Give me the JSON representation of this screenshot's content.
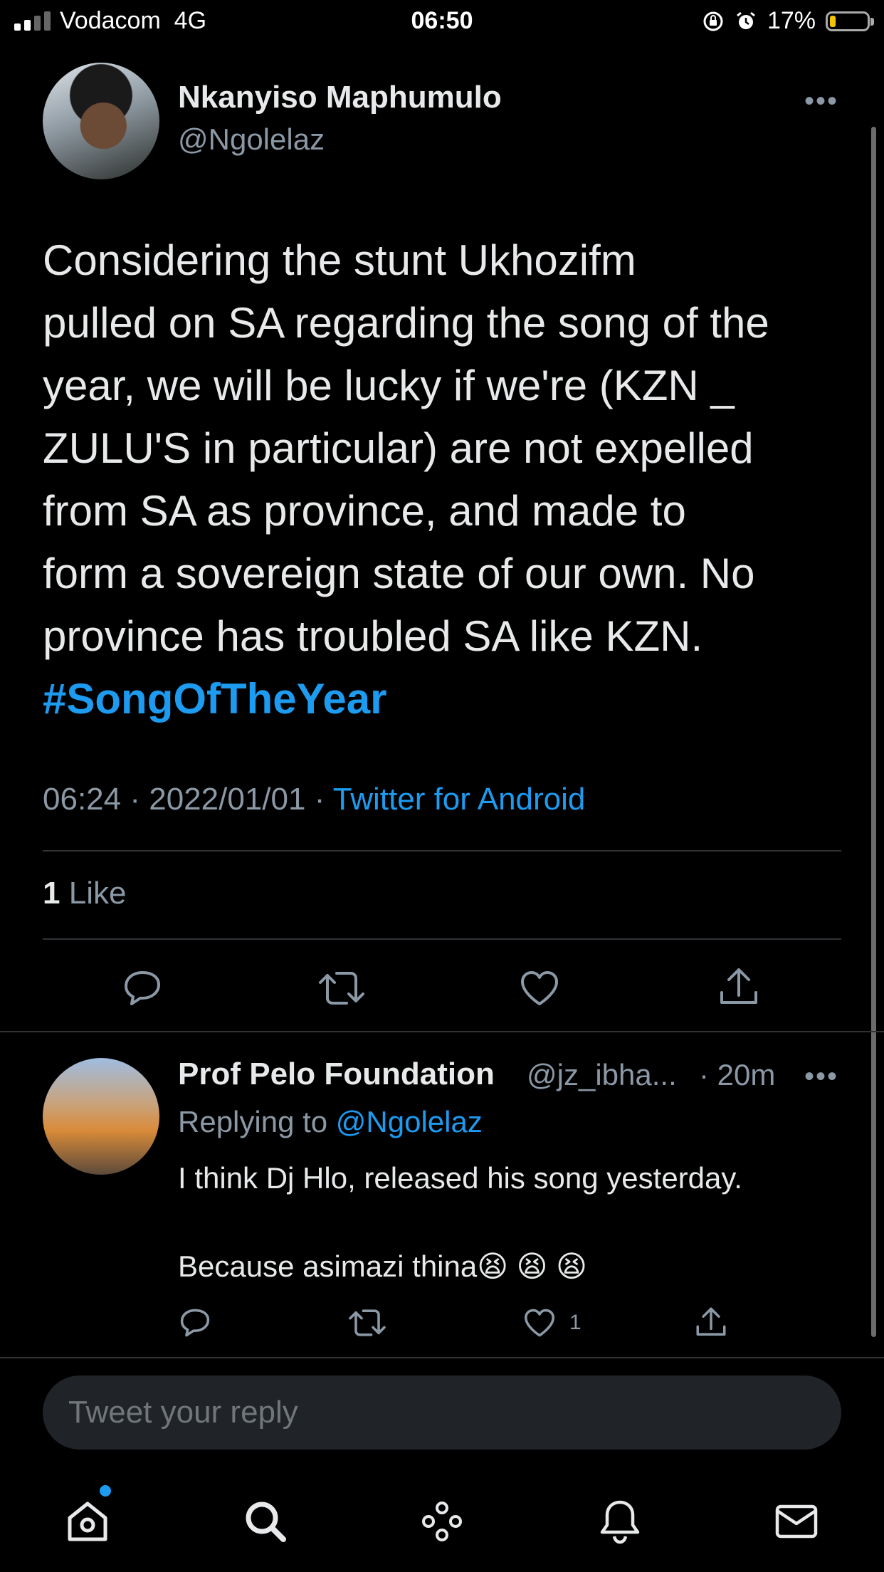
{
  "status_bar": {
    "carrier": "Vodacom",
    "network": "4G",
    "time": "06:50",
    "battery_percent": "17%",
    "battery_level": 0.17
  },
  "tweet": {
    "author_name": "Nkanyiso Maphumulo",
    "author_handle": "@Ngolelaz",
    "more_label": "•••",
    "text": "Considering the stunt Ukhozifm\npulled on SA regarding the song of the\nyear, we will be lucky if we're  (KZN _\nZULU'S in particular) are not expelled\nfrom SA as province, and made to\nform a sovereign state of our own. No\nprovince has troubled SA like KZN.",
    "hashtag": "#SongOfTheYear",
    "time": "06:24",
    "date": "2022/01/01",
    "separator": "·",
    "source": "Twitter for Android",
    "like_count": "1",
    "like_label": "Like"
  },
  "reply": {
    "author_name": "Prof Pelo Foundation",
    "author_handle": "@jz_ibha...",
    "time": "· 20m",
    "more_label": "•••",
    "replying_prefix": "Replying to",
    "replying_to": "@Ngolelaz",
    "text": "I think Dj Hlo, released his song yesterday.\n\nBecause asimazi thina😫 😫 😫",
    "like_count": "1"
  },
  "compose": {
    "placeholder": "Tweet your reply"
  },
  "icons": {
    "reply": "reply-icon",
    "retweet": "retweet-icon",
    "like": "heart-icon",
    "share": "share-icon",
    "home": "home-icon",
    "search": "search-icon",
    "spaces": "spaces-icon",
    "notifications": "bell-icon",
    "messages": "mail-icon"
  },
  "colors": {
    "background": "#000000",
    "accent": "#1d9bf0",
    "text": "#e7e9ea",
    "muted": "#8b98a5"
  }
}
